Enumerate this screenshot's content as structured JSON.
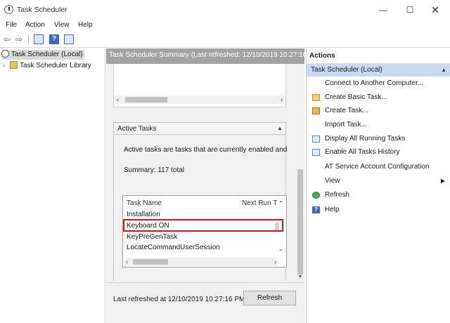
{
  "window": {
    "title": "Task Scheduler",
    "minimize": "—",
    "maximize": "☐",
    "close": "✕"
  },
  "menu": [
    "File",
    "Action",
    "View",
    "Help"
  ],
  "tree": {
    "root": "Task Scheduler (Local)",
    "library": "Task Scheduler Library"
  },
  "center": {
    "header": "Task Scheduler Summary (Last refreshed: 12/10/2019 10:27:16 PM)",
    "active_tasks": {
      "title": "Active Tasks",
      "description": "Active tasks are tasks that are currently enabled and",
      "summary": "Summary: 117 total",
      "columns": [
        "Task Name",
        "Next Run T"
      ],
      "rows": [
        "Installation",
        "Keyboard ON",
        "KeyPreGenTask",
        "LocateCommandUserSession"
      ]
    },
    "last_refreshed": "Last refreshed at 12/10/2019 10:27:16 PM",
    "refresh_button": "Refresh"
  },
  "actions": {
    "title": "Actions",
    "group": "Task Scheduler (Local)",
    "items": [
      {
        "label": "Connect to Another Computer...",
        "icon": "none"
      },
      {
        "label": "Create Basic Task...",
        "icon": "wand-icon"
      },
      {
        "label": "Create Task...",
        "icon": "task-icon"
      },
      {
        "label": "Import Task...",
        "icon": "none"
      },
      {
        "label": "Display All Running Tasks",
        "icon": "list-icon"
      },
      {
        "label": "Enable All Tasks History",
        "icon": "history-icon"
      },
      {
        "label": "AT Service Account Configuration",
        "icon": "none"
      },
      {
        "label": "View",
        "icon": "none"
      },
      {
        "label": "Refresh",
        "icon": "refresh-icon"
      },
      {
        "label": "Help",
        "icon": "help-icon"
      }
    ]
  },
  "colors": {
    "highlight": "#e0101a",
    "selected_group": "#c8d9f0",
    "header_gray": "#a3a3a3"
  }
}
